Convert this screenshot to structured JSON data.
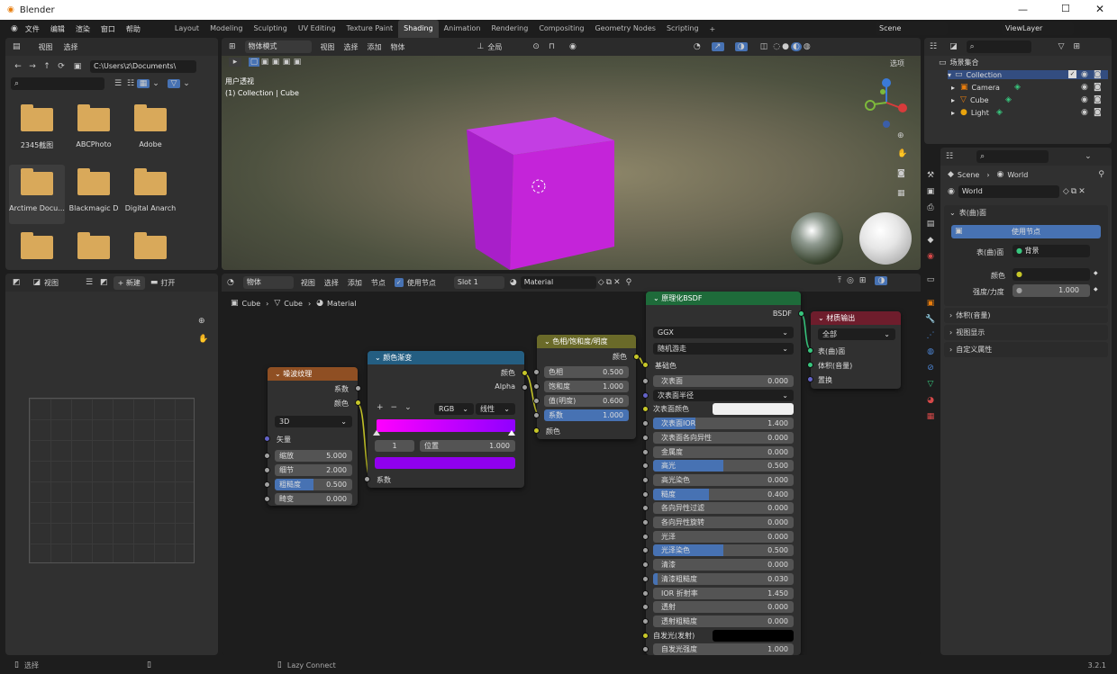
{
  "app": {
    "title": "Blender",
    "version": "3.2.1"
  },
  "menu": [
    "文件",
    "编辑",
    "渲染",
    "窗口",
    "帮助"
  ],
  "workspaces": [
    "Layout",
    "Modeling",
    "Sculpting",
    "UV Editing",
    "Texture Paint",
    "Shading",
    "Animation",
    "Rendering",
    "Compositing",
    "Geometry Nodes",
    "Scripting"
  ],
  "active_workspace": "Shading",
  "scene": "Scene",
  "view_layer": "ViewLayer",
  "file_browser": {
    "menu": [
      "视图",
      "选择"
    ],
    "path": "C:\\Users\\z\\Documents\\",
    "folders": [
      "2345截图",
      "ABCPhoto",
      "Adobe",
      "Arctime Docu...",
      "Blackmagic D",
      "Digital Anarch",
      "",
      "",
      ""
    ]
  },
  "image_editor": {
    "view": "视图",
    "new": "+ 新建",
    "open": "打开"
  },
  "viewport": {
    "mode": "物体模式",
    "menu": [
      "视图",
      "选择",
      "添加",
      "物体"
    ],
    "global": "全局",
    "options": "选项",
    "overlay1": "用户透视",
    "overlay2": "(1) Collection | Cube"
  },
  "node_editor": {
    "menu": [
      "物体",
      "视图",
      "选择",
      "添加",
      "节点"
    ],
    "use_nodes": "使用节点",
    "slot": "Slot 1",
    "material": "Material",
    "breadcrumb": [
      "Cube",
      "Cube",
      "Material"
    ]
  },
  "noise": {
    "title": "噪波纹理",
    "out_fac": "系数",
    "out_color": "颜色",
    "dim": "3D",
    "vector": "矢量",
    "fields": [
      {
        "label": "缩放",
        "value": "5.000"
      },
      {
        "label": "细节",
        "value": "2.000"
      },
      {
        "label": "粗糙度",
        "value": "0.500"
      },
      {
        "label": "畸变",
        "value": "0.000"
      }
    ],
    "roughness_fill": 0.5
  },
  "ramp": {
    "title": "颜色渐变",
    "out_color": "颜色",
    "out_alpha": "Alpha",
    "mode": "RGB",
    "interp": "线性",
    "index": "1",
    "pos_label": "位置",
    "pos_value": "1.000",
    "in_fac": "系数",
    "colors": {
      "left": "#ff00ff",
      "right": "#8f00ff",
      "swatch": "#9000ee"
    }
  },
  "hsv": {
    "title": "色相/饱和度/明度",
    "out": "颜色",
    "in_color": "颜色",
    "fields": [
      {
        "label": "色相",
        "value": "0.500"
      },
      {
        "label": "饱和度",
        "value": "1.000"
      },
      {
        "label": "值(明度)",
        "value": "0.600"
      },
      {
        "label": "系数",
        "value": "1.000"
      }
    ]
  },
  "bsdf": {
    "title": "原理化BSDF",
    "out": "BSDF",
    "dist": "GGX",
    "sss": "随机游走",
    "base_color": "基础色",
    "sss_radius": "次表面半径",
    "sss_color": "次表面颜色",
    "rows": [
      {
        "label": "次表面",
        "value": "0.000",
        "fill": 0
      },
      {
        "label": "次表面IOR",
        "value": "1.400",
        "fill": 0.3
      },
      {
        "label": "次表面各向异性",
        "value": "0.000",
        "fill": 0
      },
      {
        "label": "金属度",
        "value": "0.000",
        "fill": 0
      },
      {
        "label": "高光",
        "value": "0.500",
        "fill": 0.5
      },
      {
        "label": "高光染色",
        "value": "0.000",
        "fill": 0
      },
      {
        "label": "糙度",
        "value": "0.400",
        "fill": 0.4
      },
      {
        "label": "各向异性过滤",
        "value": "0.000",
        "fill": 0
      },
      {
        "label": "各向异性旋转",
        "value": "0.000",
        "fill": 0
      },
      {
        "label": "光泽",
        "value": "0.000",
        "fill": 0
      },
      {
        "label": "光泽染色",
        "value": "0.500",
        "fill": 0.5
      },
      {
        "label": "清漆",
        "value": "0.000",
        "fill": 0
      },
      {
        "label": "清漆粗糙度",
        "value": "0.030",
        "fill": 0.03
      },
      {
        "label": "IOR 折射率",
        "value": "1.450",
        "fill": 0
      },
      {
        "label": "透射",
        "value": "0.000",
        "fill": 0
      },
      {
        "label": "透射粗糙度",
        "value": "0.000",
        "fill": 0
      }
    ],
    "emission": "自发光(发射)",
    "emission_strength_label": "自发光强度",
    "emission_strength": "1.000"
  },
  "output": {
    "title": "材质输出",
    "target": "全部",
    "inputs": [
      "表(曲)面",
      "体积(音量)",
      "置换"
    ]
  },
  "outliner": {
    "root": "场景集合",
    "collection": "Collection",
    "items": [
      "Camera",
      "Cube",
      "Light"
    ]
  },
  "properties": {
    "breadcrumb": [
      "Scene",
      "World"
    ],
    "world": "World",
    "surface_section": "表(曲)面",
    "use_nodes": "使用节点",
    "surface_label": "表(曲)面",
    "surface_value": "背景",
    "color_label": "颜色",
    "strength_label": "强度/力度",
    "strength_value": "1.000",
    "panels": [
      "体积(音量)",
      "视图显示",
      "自定义属性"
    ]
  },
  "status": {
    "left": "选择",
    "mid": "Lazy Connect"
  }
}
